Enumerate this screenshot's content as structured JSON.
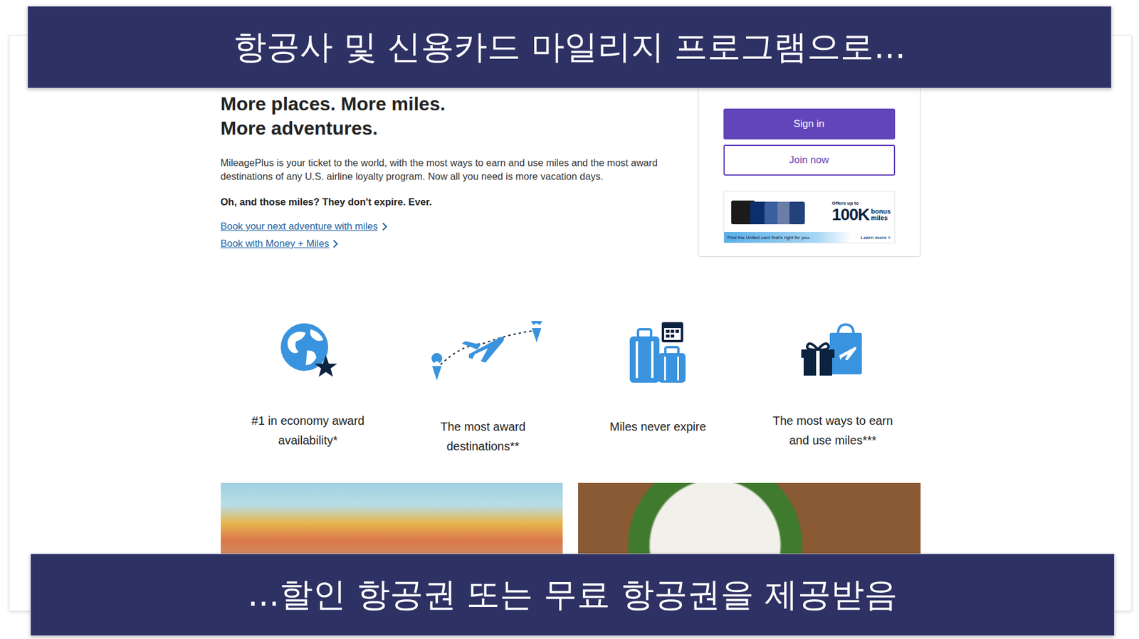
{
  "captions": {
    "top": "항공사 및 신용카드 마일리지 프로그램으로...",
    "bottom": "...할인 항공권 또는 무료 항공권을 제공받음"
  },
  "hero": {
    "title_lines": [
      "More places. More miles.",
      "More adventures."
    ],
    "description": "MileagePlus is your ticket to the world, with the most ways to earn and use miles and the most award destinations of any U.S. airline loyalty program. Now all you need is more vacation days.",
    "note": "Oh, and those miles? They don't expire. Ever.",
    "links": [
      "Book your next adventure with miles",
      "Book with Money + Miles"
    ]
  },
  "account": {
    "buttons": [
      {
        "label": "Sign in",
        "kind": "primary"
      },
      {
        "label": "Join now",
        "kind": "outline"
      }
    ],
    "promo": {
      "offer": "Offers up to",
      "amount": "100K",
      "unit_lines": [
        "bonus",
        "miles"
      ],
      "tagline": "Find the United card that's right for you.",
      "cta": "Learn more >"
    }
  },
  "features": [
    {
      "label": "#1 in economy award availability*"
    },
    {
      "label": "The most award destinations**"
    },
    {
      "label": "Miles never expire"
    },
    {
      "label": "The most ways to earn and use miles***"
    }
  ],
  "photos": [
    {
      "kind": "town"
    },
    {
      "kind": "food"
    }
  ]
}
